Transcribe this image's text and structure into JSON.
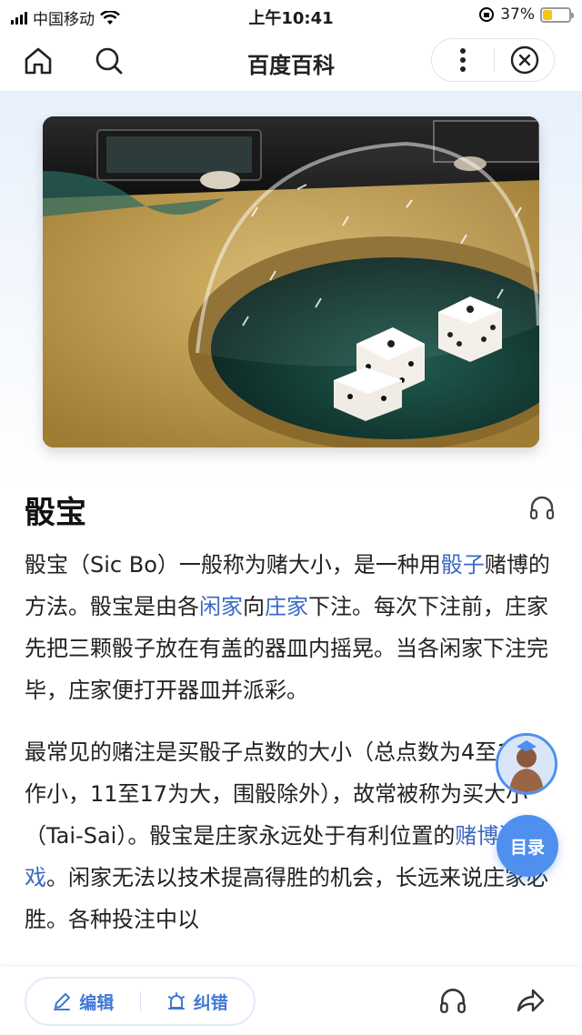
{
  "status_bar": {
    "carrier": "中国移动",
    "time": "上午10:41",
    "battery_percent": "37%"
  },
  "nav": {
    "title": "百度百科"
  },
  "article": {
    "title": "骰宝",
    "paragraph1": [
      {
        "text": "骰宝（Sic Bo）一般称为赌大小，是一种用",
        "link": false
      },
      {
        "text": "骰子",
        "link": true
      },
      {
        "text": "赌博的方法。骰宝是由各",
        "link": false
      },
      {
        "text": "闲家",
        "link": true
      },
      {
        "text": "向",
        "link": false
      },
      {
        "text": "庄家",
        "link": true
      },
      {
        "text": "下注。每次下注前，庄家先把三颗骰子放在有盖的器皿内摇晃。当各闲家下注完毕，庄家便打开器皿并派彩。",
        "link": false
      }
    ],
    "paragraph2": [
      {
        "text": "最常见的赌注是买骰子点数的大小（总点数为4至10称作小，11至17为大，围骰除外），故常被称为买大小（Tai-Sai）。骰宝是庄家永远处于有利位置的",
        "link": false
      },
      {
        "text": "赌博游戏",
        "link": true
      },
      {
        "text": "。闲家无法以技术提高得胜的机会，长远来说庄家必胜。各种投注中以",
        "link": false
      }
    ]
  },
  "floating": {
    "toc_label": "目录"
  },
  "bottom_bar": {
    "edit_label": "编辑",
    "report_label": "纠错"
  },
  "colors": {
    "link": "#3b68c4",
    "accent": "#4f8ff0"
  }
}
